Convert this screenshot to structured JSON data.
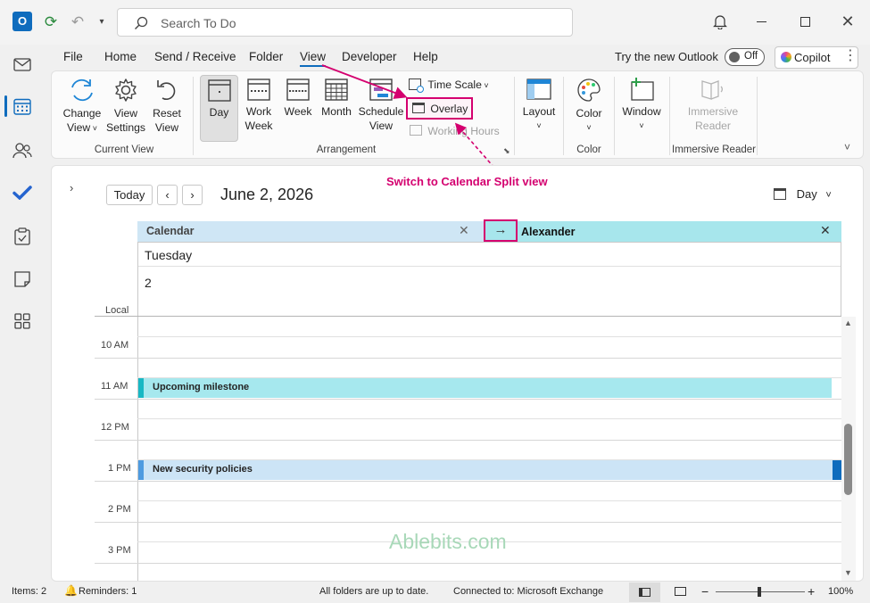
{
  "titlebar": {
    "search_placeholder": "Search To Do"
  },
  "menu": {
    "file": "File",
    "home": "Home",
    "send_receive": "Send / Receive",
    "folder": "Folder",
    "view": "View",
    "developer": "Developer",
    "help": "Help"
  },
  "new_outlook": {
    "label": "Try the new Outlook",
    "toggle": "Off"
  },
  "copilot": "Copilot",
  "ribbon": {
    "change_view": [
      "Change",
      "View"
    ],
    "view_settings": [
      "View",
      "Settings"
    ],
    "reset_view": [
      "Reset",
      "View"
    ],
    "group_current_view": "Current View",
    "day": "Day",
    "work_week": [
      "Work",
      "Week"
    ],
    "week": "Week",
    "month": "Month",
    "schedule_view": [
      "Schedule",
      "View"
    ],
    "time_scale": "Time Scale",
    "overlay": "Overlay",
    "working_hours": "Working Hours",
    "group_arrangement": "Arrangement",
    "layout": "Layout",
    "color": "Color",
    "group_color": "Color",
    "window": "Window",
    "immersive_reader": [
      "Immersive",
      "Reader"
    ],
    "group_immersive": "Immersive Reader"
  },
  "calendar": {
    "today": "Today",
    "date": "June 2, 2026",
    "view_mode": "Day",
    "annotation": "Switch to Calendar Split view",
    "tab_calendar": "Calendar",
    "tab_alexander": "Alexander",
    "weekday": "Tuesday",
    "day_number": "2",
    "local": "Local",
    "times": [
      "10 AM",
      "11 AM",
      "12 PM",
      "1 PM",
      "2 PM",
      "3 PM"
    ],
    "appointments": [
      {
        "title": "Upcoming milestone",
        "color": "#a6e8ee",
        "accent": "#18b8c4"
      },
      {
        "title": "New security policies",
        "color": "#cce4f6",
        "accent": "#0f6cbd"
      }
    ]
  },
  "watermark": "Ablebits.com",
  "status": {
    "items": "Items: 2",
    "reminders": "Reminders: 1",
    "folders": "All folders are up to date.",
    "connected": "Connected to: Microsoft Exchange",
    "zoom": "100%"
  }
}
